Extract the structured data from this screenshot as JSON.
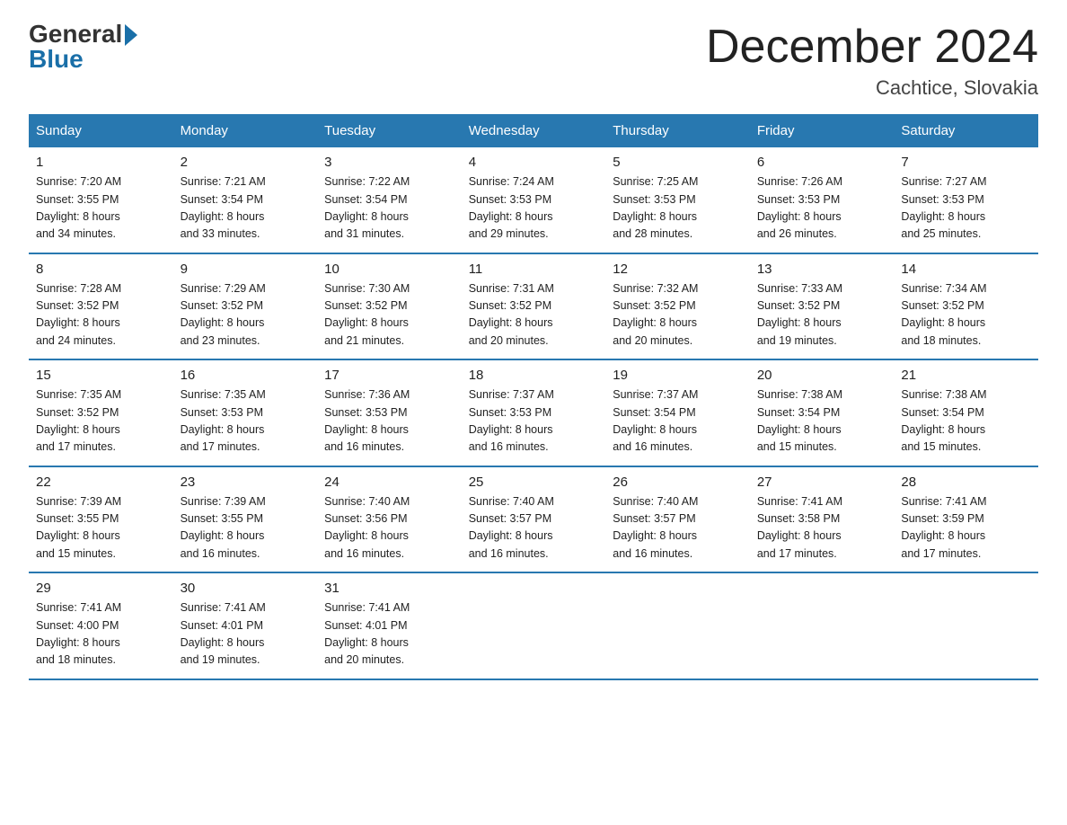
{
  "logo": {
    "general": "General",
    "blue": "Blue"
  },
  "title": "December 2024",
  "location": "Cachtice, Slovakia",
  "days_of_week": [
    "Sunday",
    "Monday",
    "Tuesday",
    "Wednesday",
    "Thursday",
    "Friday",
    "Saturday"
  ],
  "weeks": [
    [
      {
        "day": "1",
        "sunrise": "7:20 AM",
        "sunset": "3:55 PM",
        "daylight": "8 hours and 34 minutes."
      },
      {
        "day": "2",
        "sunrise": "7:21 AM",
        "sunset": "3:54 PM",
        "daylight": "8 hours and 33 minutes."
      },
      {
        "day": "3",
        "sunrise": "7:22 AM",
        "sunset": "3:54 PM",
        "daylight": "8 hours and 31 minutes."
      },
      {
        "day": "4",
        "sunrise": "7:24 AM",
        "sunset": "3:53 PM",
        "daylight": "8 hours and 29 minutes."
      },
      {
        "day": "5",
        "sunrise": "7:25 AM",
        "sunset": "3:53 PM",
        "daylight": "8 hours and 28 minutes."
      },
      {
        "day": "6",
        "sunrise": "7:26 AM",
        "sunset": "3:53 PM",
        "daylight": "8 hours and 26 minutes."
      },
      {
        "day": "7",
        "sunrise": "7:27 AM",
        "sunset": "3:53 PM",
        "daylight": "8 hours and 25 minutes."
      }
    ],
    [
      {
        "day": "8",
        "sunrise": "7:28 AM",
        "sunset": "3:52 PM",
        "daylight": "8 hours and 24 minutes."
      },
      {
        "day": "9",
        "sunrise": "7:29 AM",
        "sunset": "3:52 PM",
        "daylight": "8 hours and 23 minutes."
      },
      {
        "day": "10",
        "sunrise": "7:30 AM",
        "sunset": "3:52 PM",
        "daylight": "8 hours and 21 minutes."
      },
      {
        "day": "11",
        "sunrise": "7:31 AM",
        "sunset": "3:52 PM",
        "daylight": "8 hours and 20 minutes."
      },
      {
        "day": "12",
        "sunrise": "7:32 AM",
        "sunset": "3:52 PM",
        "daylight": "8 hours and 20 minutes."
      },
      {
        "day": "13",
        "sunrise": "7:33 AM",
        "sunset": "3:52 PM",
        "daylight": "8 hours and 19 minutes."
      },
      {
        "day": "14",
        "sunrise": "7:34 AM",
        "sunset": "3:52 PM",
        "daylight": "8 hours and 18 minutes."
      }
    ],
    [
      {
        "day": "15",
        "sunrise": "7:35 AM",
        "sunset": "3:52 PM",
        "daylight": "8 hours and 17 minutes."
      },
      {
        "day": "16",
        "sunrise": "7:35 AM",
        "sunset": "3:53 PM",
        "daylight": "8 hours and 17 minutes."
      },
      {
        "day": "17",
        "sunrise": "7:36 AM",
        "sunset": "3:53 PM",
        "daylight": "8 hours and 16 minutes."
      },
      {
        "day": "18",
        "sunrise": "7:37 AM",
        "sunset": "3:53 PM",
        "daylight": "8 hours and 16 minutes."
      },
      {
        "day": "19",
        "sunrise": "7:37 AM",
        "sunset": "3:54 PM",
        "daylight": "8 hours and 16 minutes."
      },
      {
        "day": "20",
        "sunrise": "7:38 AM",
        "sunset": "3:54 PM",
        "daylight": "8 hours and 15 minutes."
      },
      {
        "day": "21",
        "sunrise": "7:38 AM",
        "sunset": "3:54 PM",
        "daylight": "8 hours and 15 minutes."
      }
    ],
    [
      {
        "day": "22",
        "sunrise": "7:39 AM",
        "sunset": "3:55 PM",
        "daylight": "8 hours and 15 minutes."
      },
      {
        "day": "23",
        "sunrise": "7:39 AM",
        "sunset": "3:55 PM",
        "daylight": "8 hours and 16 minutes."
      },
      {
        "day": "24",
        "sunrise": "7:40 AM",
        "sunset": "3:56 PM",
        "daylight": "8 hours and 16 minutes."
      },
      {
        "day": "25",
        "sunrise": "7:40 AM",
        "sunset": "3:57 PM",
        "daylight": "8 hours and 16 minutes."
      },
      {
        "day": "26",
        "sunrise": "7:40 AM",
        "sunset": "3:57 PM",
        "daylight": "8 hours and 16 minutes."
      },
      {
        "day": "27",
        "sunrise": "7:41 AM",
        "sunset": "3:58 PM",
        "daylight": "8 hours and 17 minutes."
      },
      {
        "day": "28",
        "sunrise": "7:41 AM",
        "sunset": "3:59 PM",
        "daylight": "8 hours and 17 minutes."
      }
    ],
    [
      {
        "day": "29",
        "sunrise": "7:41 AM",
        "sunset": "4:00 PM",
        "daylight": "8 hours and 18 minutes."
      },
      {
        "day": "30",
        "sunrise": "7:41 AM",
        "sunset": "4:01 PM",
        "daylight": "8 hours and 19 minutes."
      },
      {
        "day": "31",
        "sunrise": "7:41 AM",
        "sunset": "4:01 PM",
        "daylight": "8 hours and 20 minutes."
      },
      {
        "day": "",
        "sunrise": "",
        "sunset": "",
        "daylight": ""
      },
      {
        "day": "",
        "sunrise": "",
        "sunset": "",
        "daylight": ""
      },
      {
        "day": "",
        "sunrise": "",
        "sunset": "",
        "daylight": ""
      },
      {
        "day": "",
        "sunrise": "",
        "sunset": "",
        "daylight": ""
      }
    ]
  ],
  "labels": {
    "sunrise": "Sunrise:",
    "sunset": "Sunset:",
    "daylight": "Daylight:"
  }
}
